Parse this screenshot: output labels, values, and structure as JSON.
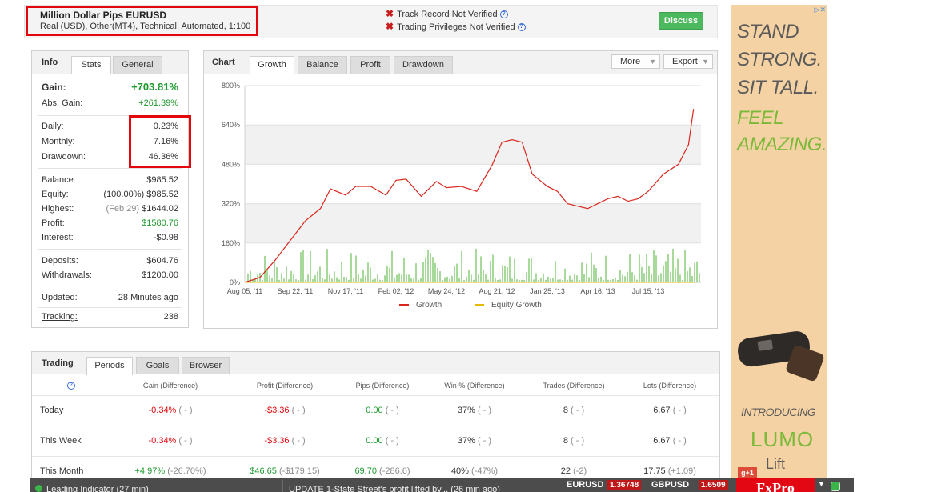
{
  "header": {
    "system_name": "Million Dollar Pips EURUSD",
    "system_desc": "Real (USD), Other(MT4), Technical, Automated, 1:100",
    "track_record": "Track Record Not Verified",
    "trading_privileges": "Trading Privileges Not Verified",
    "discuss_label": "Discuss"
  },
  "info": {
    "tabs": [
      "Info",
      "Stats",
      "General"
    ],
    "gain_label": "Gain:",
    "gain_value": "+703.81%",
    "abs_gain_label": "Abs. Gain:",
    "abs_gain_value": "+261.39%",
    "daily_label": "Daily:",
    "daily_value": "0.23%",
    "monthly_label": "Monthly:",
    "monthly_value": "7.16%",
    "drawdown_label": "Drawdown:",
    "drawdown_value": "46.36%",
    "balance_label": "Balance:",
    "balance_value": "$985.52",
    "equity_label": "Equity:",
    "equity_pct": "(100.00%)",
    "equity_value": "$985.52",
    "highest_label": "Highest:",
    "highest_date": "(Feb 29)",
    "highest_value": "$1644.02",
    "profit_label": "Profit:",
    "profit_value": "$1580.76",
    "interest_label": "Interest:",
    "interest_value": "-$0.98",
    "deposits_label": "Deposits:",
    "deposits_value": "$604.76",
    "withdrawals_label": "Withdrawals:",
    "withdrawals_value": "$1200.00",
    "updated_label": "Updated:",
    "updated_value": "28 Minutes ago",
    "tracking_label": "Tracking:",
    "tracking_value": "238"
  },
  "chart_panel": {
    "label": "Chart",
    "tabs": [
      "Growth",
      "Balance",
      "Profit",
      "Drawdown"
    ],
    "more_label": "More",
    "export_label": "Export",
    "legend_growth": "Growth",
    "legend_equity": "Equity Growth",
    "growth_color": "#d9261c",
    "equity_color": "#e6b800",
    "bar_color": "#a6d99a"
  },
  "chart_data": {
    "type": "line",
    "x_tick_labels": [
      "Aug 05, '11",
      "Sep 22, '11",
      "Nov 17, '11",
      "Feb 02, '12",
      "May 24, '12",
      "Aug 21, '12",
      "Jan 25, '13",
      "Apr 16, '13",
      "Jul 15, '13"
    ],
    "y_tick_labels": [
      "0%",
      "160%",
      "320%",
      "480%",
      "640%",
      "800%"
    ],
    "ylim": [
      0,
      800
    ],
    "grid": true,
    "legend_position": "bottom",
    "series": [
      {
        "name": "Growth",
        "x_index": [
          0,
          0.3,
          0.6,
          0.9,
          1.2,
          1.5,
          1.7,
          2.0,
          2.2,
          2.5,
          2.8,
          3.0,
          3.2,
          3.5,
          3.8,
          4.0,
          4.3,
          4.6,
          4.9,
          5.1,
          5.3,
          5.5,
          5.7,
          6.0,
          6.2,
          6.4,
          6.6,
          6.8,
          7.0,
          7.2,
          7.4,
          7.6,
          7.8,
          8.0,
          8.3,
          8.6,
          8.8,
          8.9
        ],
        "values": [
          0,
          20,
          90,
          170,
          250,
          300,
          380,
          355,
          390,
          390,
          355,
          415,
          420,
          350,
          410,
          385,
          390,
          370,
          475,
          570,
          580,
          570,
          440,
          390,
          370,
          320,
          310,
          300,
          320,
          340,
          350,
          330,
          340,
          370,
          440,
          480,
          560,
          705
        ]
      },
      {
        "name": "Equity Growth",
        "x_index": [
          0,
          8.9
        ],
        "values": [
          0,
          0
        ]
      }
    ]
  },
  "trading": {
    "label": "Trading",
    "tabs": [
      "Periods",
      "Goals",
      "Browser"
    ],
    "columns": [
      "Gain (Difference)",
      "Profit (Difference)",
      "Pips (Difference)",
      "Win % (Difference)",
      "Trades (Difference)",
      "Lots (Difference)"
    ],
    "rows": [
      {
        "period": "Today",
        "gain": "-0.34%",
        "gain_diff": "( - )",
        "profit": "-$3.36",
        "profit_diff": "( - )",
        "pips": "0.00",
        "pips_diff": "( - )",
        "win": "37%",
        "win_diff": "( - )",
        "trades": "8",
        "trades_diff": "( - )",
        "lots": "6.67",
        "lots_diff": "( - )"
      },
      {
        "period": "This Week",
        "gain": "-0.34%",
        "gain_diff": "( - )",
        "profit": "-$3.36",
        "profit_diff": "( - )",
        "pips": "0.00",
        "pips_diff": "( - )",
        "win": "37%",
        "win_diff": "( - )",
        "trades": "8",
        "trades_diff": "( - )",
        "lots": "6.67",
        "lots_diff": "( - )"
      },
      {
        "period": "This Month",
        "gain": "+4.97%",
        "gain_diff": "(-26.70%)",
        "profit": "$46.65",
        "profit_diff": "(-$179.15)",
        "pips": "69.70",
        "pips_diff": "(-286.6)",
        "win": "40%",
        "win_diff": "(-47%)",
        "trades": "22",
        "trades_diff": "(-2)",
        "lots": "17.75",
        "lots_diff": "(+1.09)"
      }
    ]
  },
  "ad": {
    "line1": "STAND",
    "line2": "STRONG.",
    "line3": "SIT TALL.",
    "line4": "FEEL",
    "line5": "AMAZING.",
    "introducing": "INTRODUCING",
    "brand": "LUMO",
    "brand_sub": "Lift",
    "gplus": "g+1"
  },
  "ticker": {
    "news1": "Leading Indicator (27 min)",
    "news2": "UPDATE 1-State Street's profit lifted by... (26 min ago)",
    "pair1": "EURUSD",
    "price1": "1.36748",
    "pair2": "GBPUSD",
    "price2": "1.6509",
    "brand": "FxPro"
  }
}
